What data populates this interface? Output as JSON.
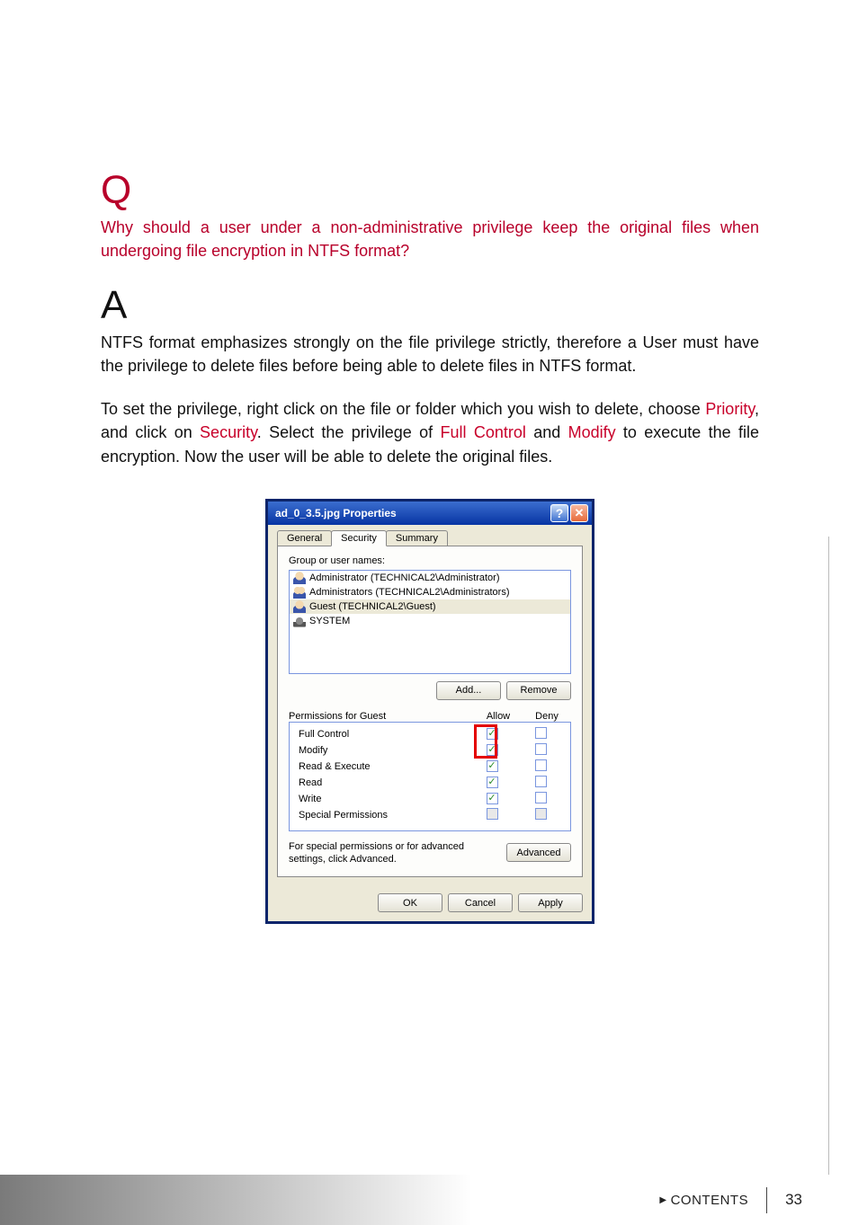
{
  "q_letter": "Q",
  "question": "Why should a user under a non-administrative privilege keep the original files when undergoing file encryption in NTFS format?",
  "a_letter": "A",
  "answer_p1": "NTFS format emphasizes strongly on the file privilege strictly, therefore a User must have the privilege to delete files before being able to delete files in NTFS format.",
  "answer_p2_a": "To set the privilege, right click on the file or folder which you wish to delete, choose ",
  "answer_p2_hl1": "Priority",
  "answer_p2_b": ", and click on ",
  "answer_p2_hl2": "Security",
  "answer_p2_c": ". Select the privilege of ",
  "answer_p2_hl3": "Full Control",
  "answer_p2_d": " and ",
  "answer_p2_hl4": "Modify",
  "answer_p2_e": " to execute the file encryption. Now the user will be able to delete the original files.",
  "dialog": {
    "title": "ad_0_3.5.jpg Properties",
    "help_glyph": "?",
    "close_glyph": "✕",
    "tabs": {
      "general": "General",
      "security": "Security",
      "summary": "Summary"
    },
    "group_label": "Group or user names:",
    "users": {
      "u0": "Administrator (TECHNICAL2\\Administrator)",
      "u1": "Administrators (TECHNICAL2\\Administrators)",
      "u2": "Guest (TECHNICAL2\\Guest)",
      "u3": "SYSTEM"
    },
    "add_btn": "Add...",
    "remove_btn": "Remove",
    "perm_label": "Permissions for Guest",
    "col_allow": "Allow",
    "col_deny": "Deny",
    "perms": {
      "p0": "Full Control",
      "p1": "Modify",
      "p2": "Read & Execute",
      "p3": "Read",
      "p4": "Write",
      "p5": "Special Permissions"
    },
    "check": "✓",
    "adv_text": "For special permissions or for advanced settings, click Advanced.",
    "adv_btn": "Advanced",
    "ok_btn": "OK",
    "cancel_btn": "Cancel",
    "apply_btn": "Apply"
  },
  "footer": {
    "contents": "CONTENTS",
    "tri": "▶",
    "page": "33"
  }
}
